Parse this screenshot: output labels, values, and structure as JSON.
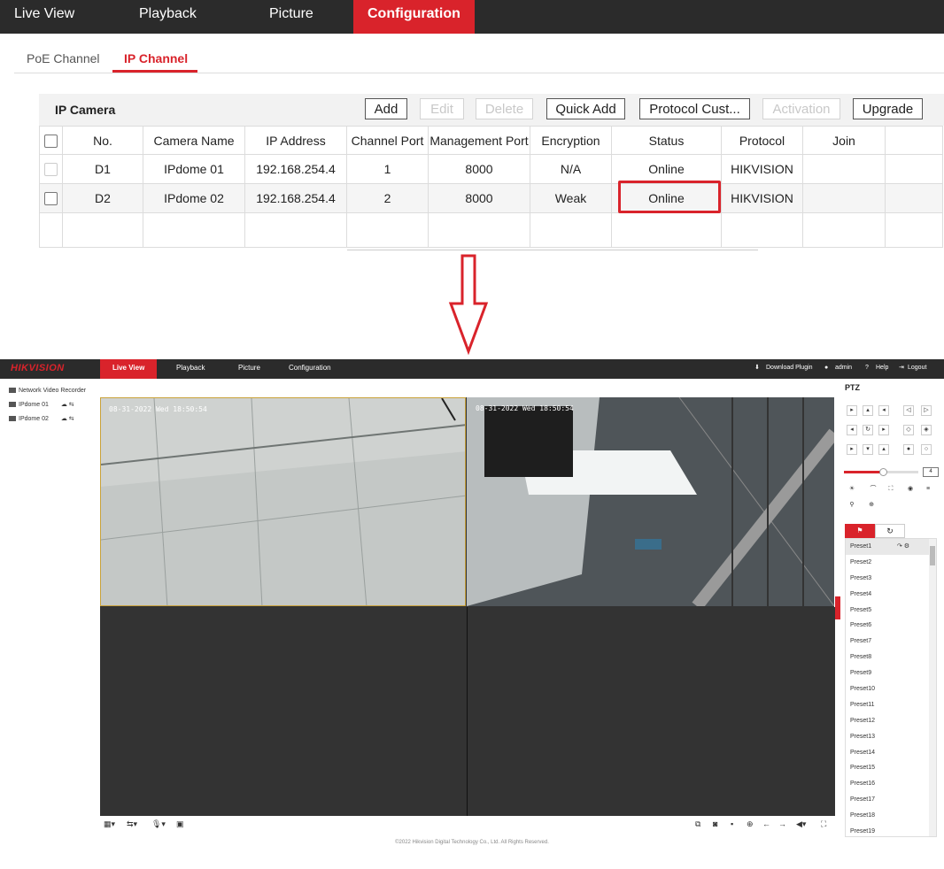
{
  "config_nav": {
    "items": [
      "Live View",
      "Playback",
      "Picture",
      "Configuration"
    ],
    "active": "Configuration"
  },
  "subtabs": [
    "PoE Channel",
    "IP Channel"
  ],
  "ip_camera": {
    "title": "IP Camera",
    "buttons": {
      "add": "Add",
      "edit": "Edit",
      "delete": "Delete",
      "quick_add": "Quick Add",
      "protocol": "Protocol Cust...",
      "activation": "Activation",
      "upgrade": "Upgrade"
    },
    "columns": [
      "No.",
      "Camera Name",
      "IP Address",
      "Channel Port",
      "Management Port",
      "Encryption",
      "Status",
      "Protocol",
      "Join"
    ],
    "rows": [
      {
        "no": "D1",
        "name": "IPdome 01",
        "ip": "192.168.254.4",
        "channel_port": "1",
        "mgmt_port": "8000",
        "encryption": "N/A",
        "status": "Online",
        "protocol": "HIKVISION",
        "join": ""
      },
      {
        "no": "D2",
        "name": "IPdome 02",
        "ip": "192.168.254.4",
        "channel_port": "2",
        "mgmt_port": "8000",
        "encryption": "Weak",
        "status": "Online",
        "protocol": "HIKVISION",
        "join": ""
      }
    ]
  },
  "live_view": {
    "logo": "HIKVISION",
    "nav": [
      "Live View",
      "Playback",
      "Picture",
      "Configuration"
    ],
    "top_right": {
      "download": "Download Plugin",
      "user": "admin",
      "help": "Help",
      "logout": "Logout"
    },
    "tree": {
      "root": "Network Video Recorder",
      "cameras": [
        "IPdome 01",
        "IPdome 02"
      ]
    },
    "osd": {
      "pane1": "08-31-2022 Wed 18:50:54",
      "pane2": "08-31-2022 Wed 18:50:54"
    },
    "ptz": {
      "title": "PTZ",
      "speed": "4"
    },
    "presets": [
      "Preset1",
      "Preset2",
      "Preset3",
      "Preset4",
      "Preset5",
      "Preset6",
      "Preset7",
      "Preset8",
      "Preset9",
      "Preset10",
      "Preset11",
      "Preset12",
      "Preset13",
      "Preset14",
      "Preset15",
      "Preset16",
      "Preset17",
      "Preset18",
      "Preset19"
    ],
    "copyright": "©2022 Hikvision Digital Technology Co., Ltd. All Rights Reserved."
  },
  "colors": {
    "accent": "#d9232b",
    "nav_bg": "#2b2b2b"
  }
}
